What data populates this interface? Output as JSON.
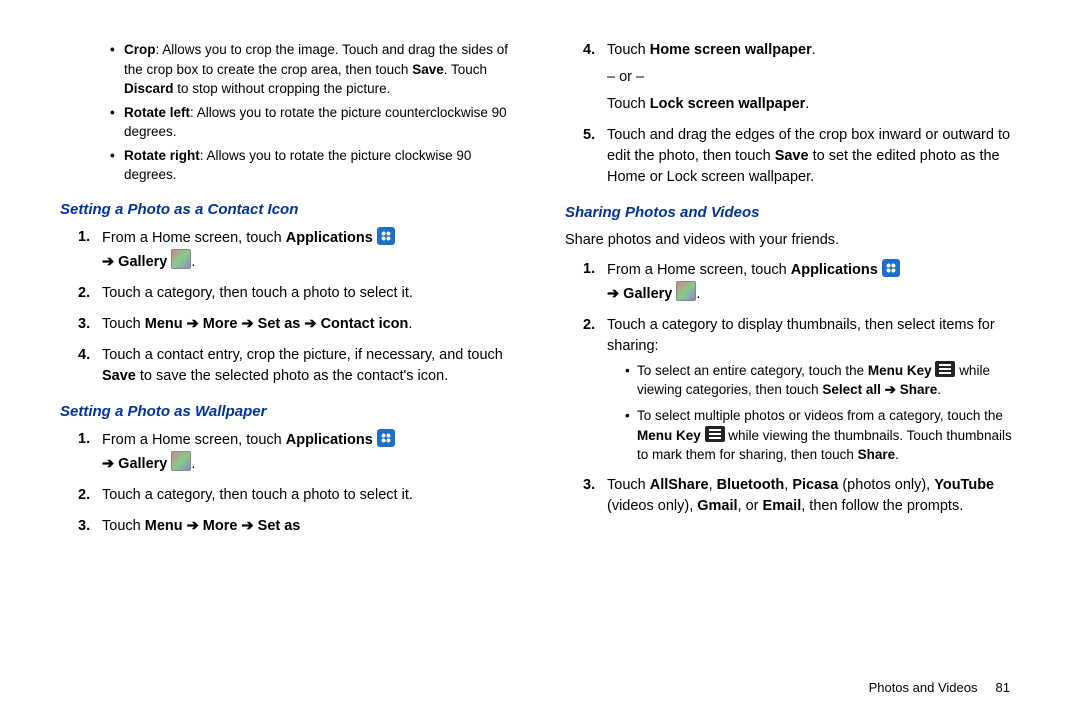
{
  "left": {
    "bullets": [
      {
        "label": "Crop",
        "text": ": Allows you to crop the image. Touch and drag the sides of the crop box to create the crop area, then touch ",
        "bold1": "Save",
        "mid": ". Touch ",
        "bold2": "Discard",
        "tail": " to stop without cropping the picture."
      },
      {
        "label": "Rotate left",
        "text": ": Allows you to rotate the picture counterclockwise 90 degrees."
      },
      {
        "label": "Rotate right",
        "text": ": Allows you to rotate the picture clockwise 90 degrees."
      }
    ],
    "h1": "Setting a Photo as a Contact Icon",
    "s1": {
      "n1": "1.",
      "t1a": "From a Home screen, touch ",
      "t1b": "Applications",
      "t1c": "➔ Gallery",
      "t1d": ".",
      "n2": "2.",
      "t2": "Touch a category, then touch a photo to select it.",
      "n3": "3.",
      "t3a": "Touch ",
      "t3b": "Menu ➔ More ➔ Set as ➔ Contact icon",
      "t3c": ".",
      "n4": "4.",
      "t4a": "Touch a contact entry, crop the picture, if necessary, and touch ",
      "t4b": "Save",
      "t4c": " to save the selected photo as the contact's icon."
    },
    "h2": "Setting a Photo as Wallpaper",
    "s2": {
      "n1": "1.",
      "t1a": "From a Home screen, touch ",
      "t1b": "Applications",
      "t1c": "➔ Gallery",
      "t1d": ".",
      "n2": "2.",
      "t2": "Touch a category, then touch a photo to select it.",
      "n3": "3.",
      "t3a": "Touch ",
      "t3b": "Menu ➔ More ➔ Set as"
    }
  },
  "right": {
    "s1": {
      "n4": "4.",
      "t4a": "Touch ",
      "t4b": "Home screen wallpaper",
      "t4c": ".",
      "or": "– or –",
      "t4d": "Touch ",
      "t4e": "Lock screen wallpaper",
      "t4f": ".",
      "n5": "5.",
      "t5a": "Touch and drag the edges of the crop box inward or outward to edit the photo, then touch ",
      "t5b": "Save",
      "t5c": " to set the edited photo as the Home or Lock screen wallpaper."
    },
    "h3": "Sharing Photos and Videos",
    "intro": "Share photos and videos with your friends.",
    "s3": {
      "n1": "1.",
      "t1a": "From a Home screen, touch ",
      "t1b": "Applications",
      "t1c": "➔ Gallery",
      "t1d": ".",
      "n2": "2.",
      "t2": "Touch a category to display thumbnails, then select items for sharing:",
      "sub1a": "To select an entire category, touch the ",
      "sub1b": "Menu Key",
      "sub1c": " while viewing categories, then touch ",
      "sub1d": "Select all ➔ Share",
      "sub1e": ".",
      "sub2a": "To select multiple photos or videos from a category, touch the ",
      "sub2b": "Menu Key",
      "sub2c": " while viewing the thumbnails. Touch thumbnails to mark them for sharing, then touch ",
      "sub2d": "Share",
      "sub2e": ".",
      "n3": "3.",
      "t3a": "Touch ",
      "t3b": "AllShare",
      "t3c": ", ",
      "t3d": "Bluetooth",
      "t3e": ", ",
      "t3f": "Picasa",
      "t3g": " (photos only), ",
      "t3h": "YouTube",
      "t3i": " (videos only), ",
      "t3j": "Gmail",
      "t3k": ", or ",
      "t3l": "Email",
      "t3m": ", then follow the prompts."
    }
  },
  "footer": {
    "section": "Photos and Videos",
    "page": "81"
  }
}
